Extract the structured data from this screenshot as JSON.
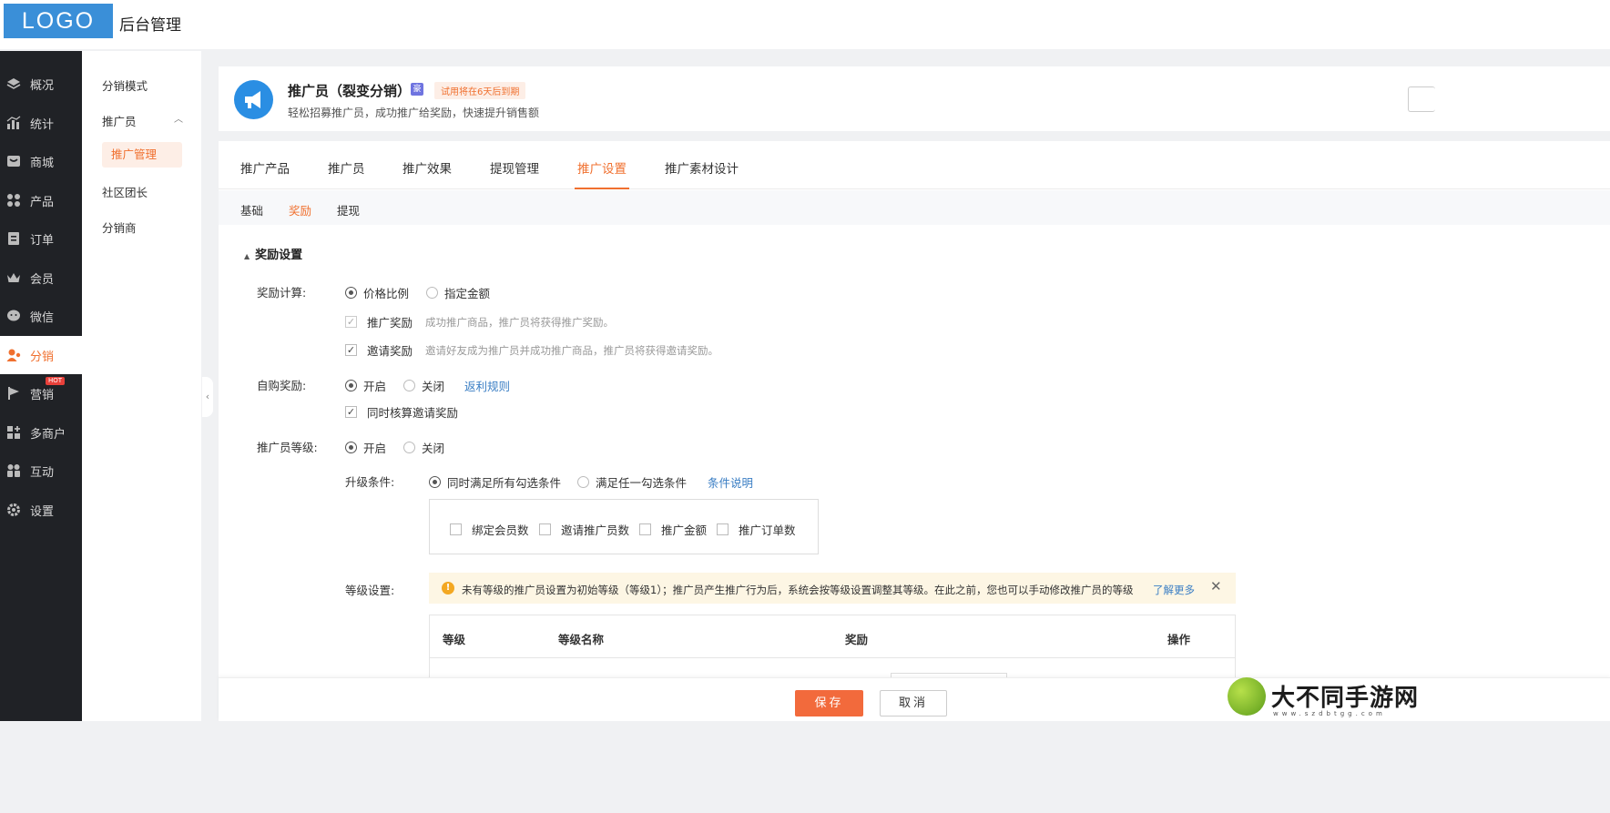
{
  "header": {
    "logo": "LOGO",
    "title": "后台管理"
  },
  "sidebar": {
    "items": [
      {
        "label": "概况",
        "icon": "layers-icon"
      },
      {
        "label": "统计",
        "icon": "stats-icon"
      },
      {
        "label": "商城",
        "icon": "store-icon"
      },
      {
        "label": "产品",
        "icon": "grid-icon"
      },
      {
        "label": "订单",
        "icon": "order-icon"
      },
      {
        "label": "会员",
        "icon": "crown-icon"
      },
      {
        "label": "微信",
        "icon": "wechat-icon"
      },
      {
        "label": "分销",
        "icon": "user-share-icon",
        "active": true
      },
      {
        "label": "营销",
        "icon": "flag-icon",
        "badge": "HOT"
      },
      {
        "label": "多商户",
        "icon": "merchant-icon"
      },
      {
        "label": "互动",
        "icon": "interact-icon"
      },
      {
        "label": "设置",
        "icon": "gear-icon"
      }
    ],
    "active_color": "#f0702f"
  },
  "subnav": {
    "items": [
      "分销模式",
      "推广员",
      "社区团长",
      "分销商"
    ],
    "expanded_child": "推广管理"
  },
  "app_card": {
    "title": "推广员（裂变分销）",
    "badge": "豪",
    "trial": "试用将在6天后到期",
    "description": "轻松招募推广员，成功推广给奖励，快速提升销售额"
  },
  "tabs": [
    "推广产品",
    "推广员",
    "推广效果",
    "提现管理",
    "推广设置",
    "推广素材设计"
  ],
  "active_tab": "推广设置",
  "subtabs": [
    "基础",
    "奖励",
    "提现"
  ],
  "active_subtab": "奖励",
  "form": {
    "section_title": "奖励设置",
    "reward_calc": {
      "label": "奖励计算:",
      "options": [
        "价格比例",
        "指定金额"
      ],
      "selected": "价格比例",
      "promo_reward": {
        "label": "推广奖励",
        "hint": "成功推广商品，推广员将获得推广奖励。",
        "checked": true,
        "disabled": true
      },
      "invite_reward": {
        "label": "邀请奖励",
        "hint": "邀请好友成为推广员并成功推广商品，推广员将获得邀请奖励。",
        "checked": true
      }
    },
    "self_purchase": {
      "label": "自购奖励:",
      "options": [
        "开启",
        "关闭"
      ],
      "selected": "开启",
      "rule_link": "返利规则",
      "also_invite": {
        "label": "同时核算邀请奖励",
        "checked": true
      }
    },
    "level": {
      "label": "推广员等级:",
      "options": [
        "开启",
        "关闭"
      ],
      "selected": "开启"
    },
    "upgrade": {
      "label": "升级条件:",
      "options": [
        "同时满足所有勾选条件",
        "满足任一勾选条件"
      ],
      "selected": "同时满足所有勾选条件",
      "explain_link": "条件说明",
      "conditions": [
        "绑定会员数",
        "邀请推广员数",
        "推广金额",
        "推广订单数"
      ]
    },
    "level_settings": {
      "label": "等级设置:",
      "notice": "未有等级的推广员设置为初始等级（等级1）；推广员产生推广行为后，系统会按等级设置调整其等级。在此之前，您也可以手动修改推广员的等级",
      "learn_more": "了解更多",
      "close": "✕",
      "columns": [
        "等级",
        "等级名称",
        "奖励",
        "操作"
      ]
    }
  },
  "footer": {
    "save": "保存",
    "cancel": "取消"
  },
  "watermark": {
    "text": "大不同手游网",
    "url": "www.szdbtgg.com"
  }
}
